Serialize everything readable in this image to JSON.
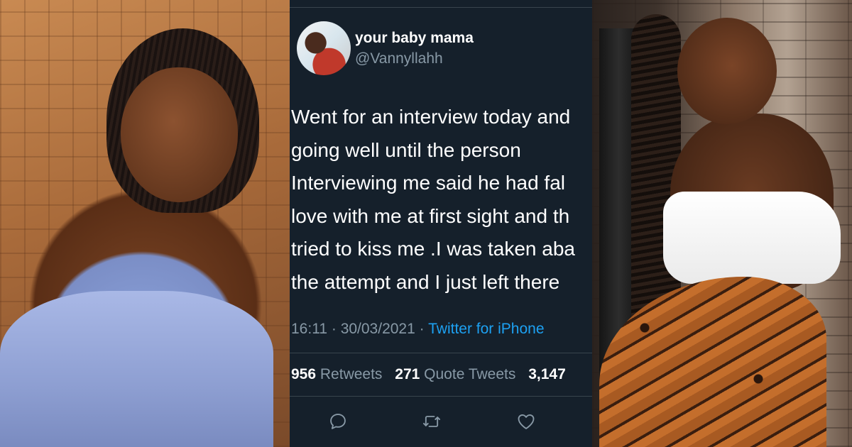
{
  "tweet": {
    "display_name": "your baby mama",
    "handle": "@Vannyllahh",
    "body_lines": [
      "Went for an interview today and",
      "going well until the person",
      "Interviewing me said he had fal",
      "love with me at first sight and th",
      "tried to kiss me .I was taken aba",
      "the attempt and I just left there"
    ],
    "time": "16:11",
    "date": "30/03/2021",
    "separator": "·",
    "source": "Twitter for iPhone",
    "stats": {
      "retweets_count": "956",
      "retweets_label": "Retweets",
      "quotes_count": "271",
      "quotes_label": "Quote Tweets",
      "likes_count": "3,147"
    },
    "actions": [
      "reply-icon",
      "retweet-icon",
      "like-icon"
    ],
    "colors": {
      "background": "#15202b",
      "secondary_text": "#8899a6",
      "link": "#1da1f2",
      "divider": "#38444d"
    }
  },
  "photos": {
    "left": "woman-photo-left",
    "right": "woman-photo-right"
  }
}
